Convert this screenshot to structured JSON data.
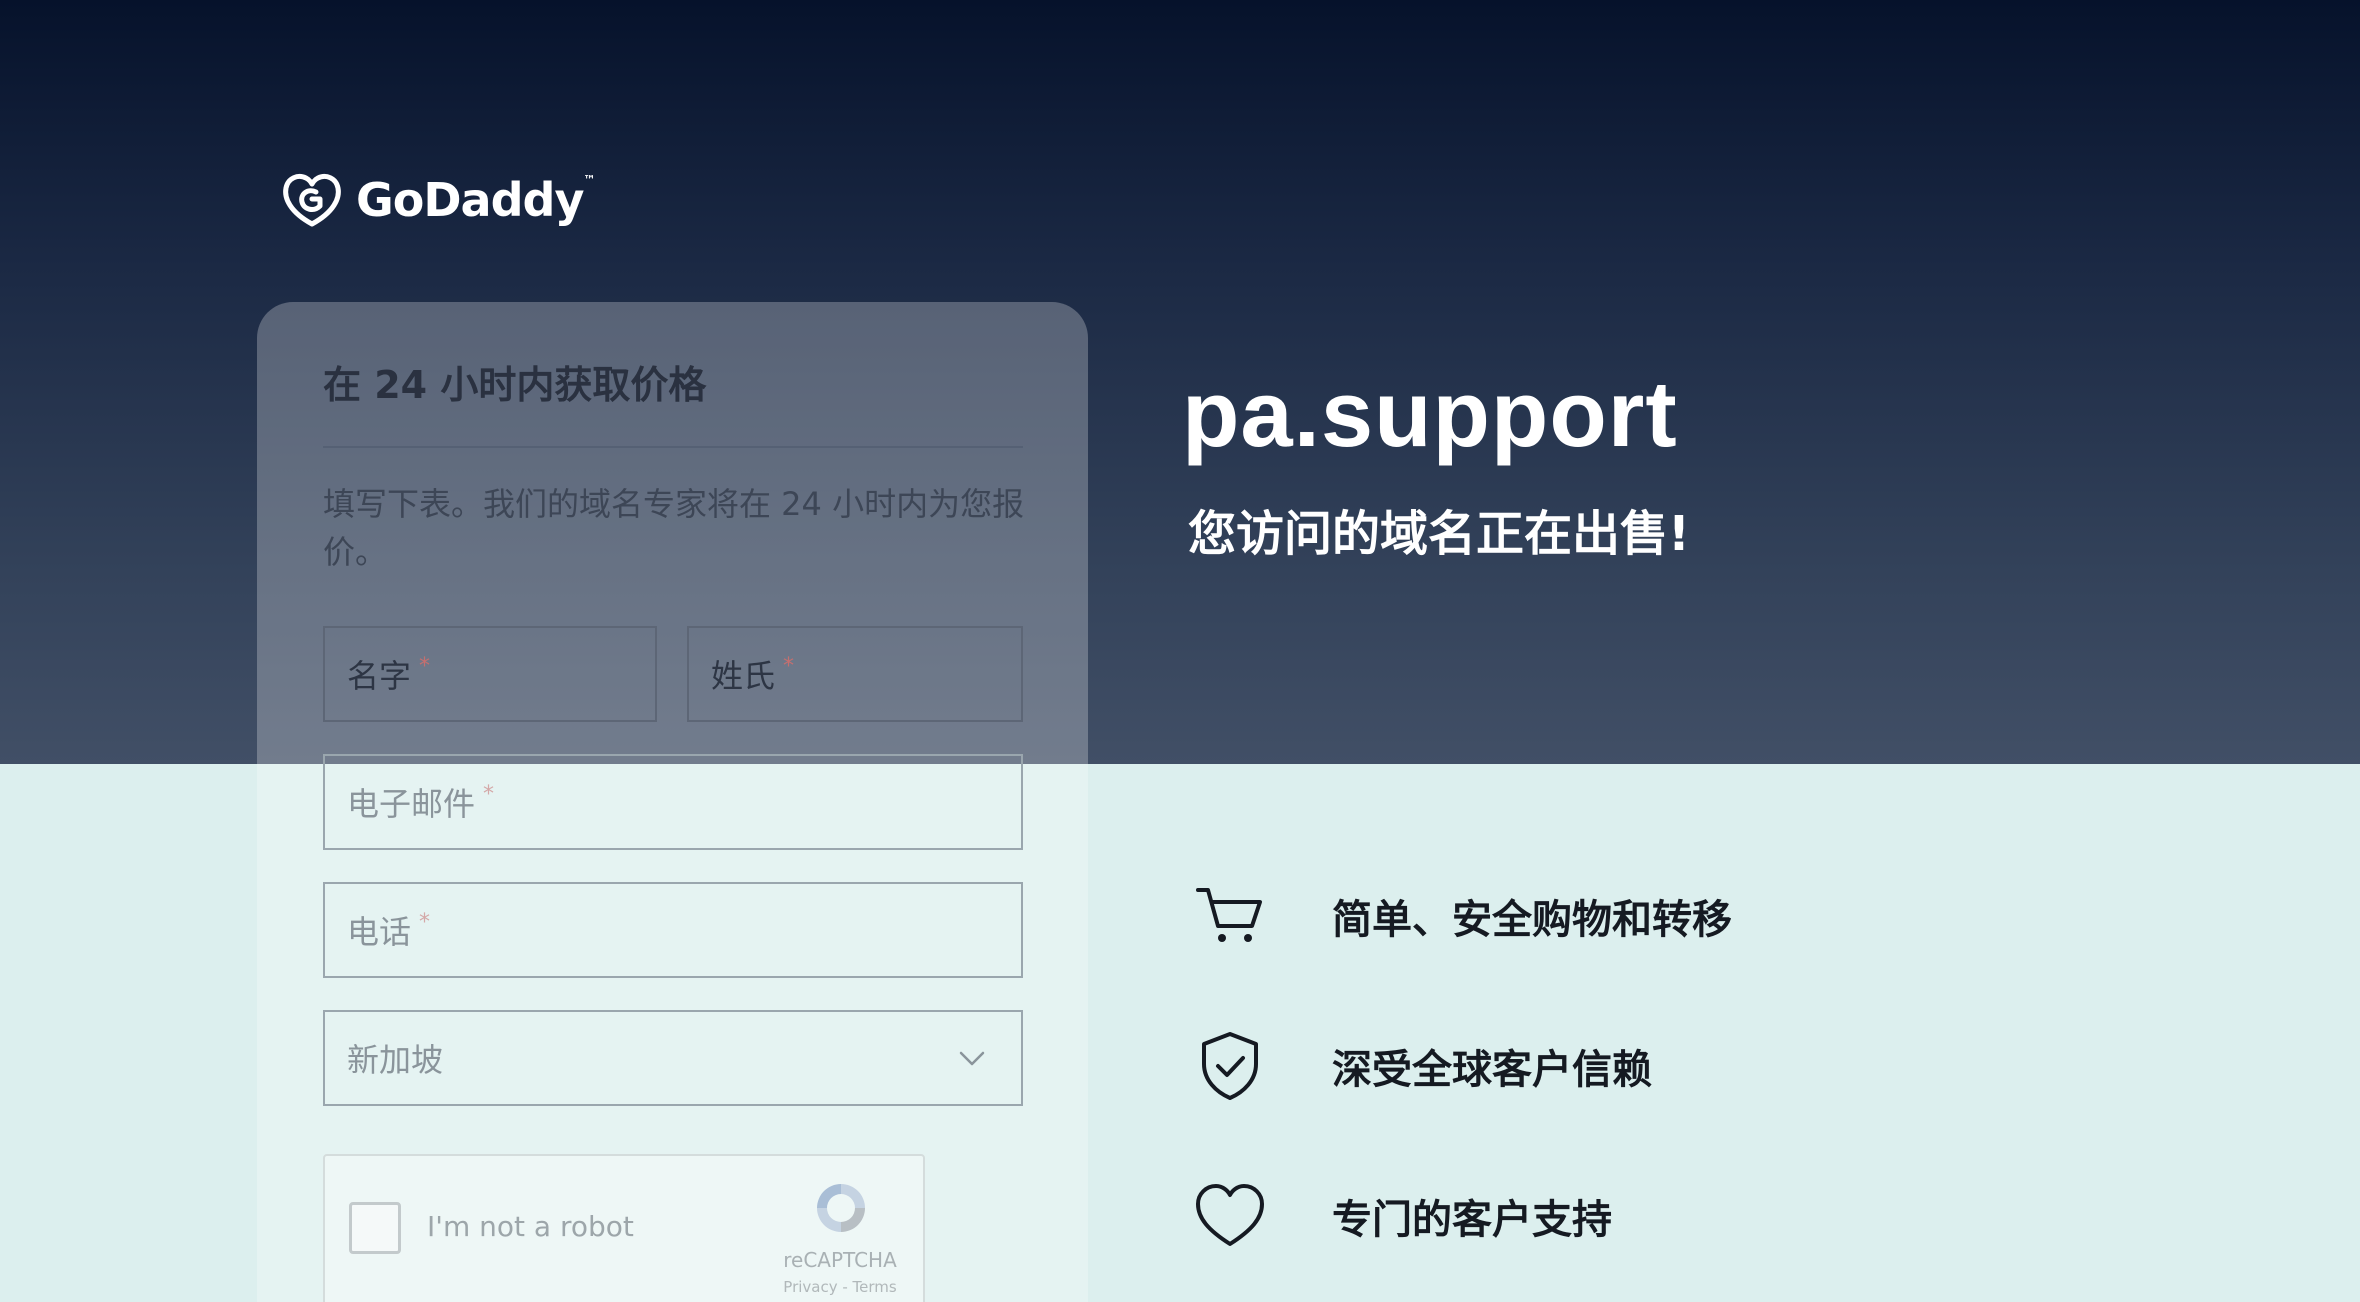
{
  "brand": {
    "name": "GoDaddy",
    "trademark": "™"
  },
  "form": {
    "title": "在 24 小时内获取价格",
    "description": "填写下表。我们的域名专家将在 24 小时内为您报价。",
    "fields": {
      "first_name": "名字",
      "last_name": "姓氏",
      "email": "电子邮件",
      "phone": "电话",
      "country": "新加坡"
    },
    "required_mark": "*"
  },
  "captcha": {
    "label": "I'm not a robot",
    "brand": "reCAPTCHA",
    "links": "Privacy - Terms"
  },
  "hero": {
    "domain": "pa.support",
    "subtitle": "您访问的域名正在出售!"
  },
  "features": [
    {
      "icon": "shopping-cart-icon",
      "label": "简单、安全购物和转移"
    },
    {
      "icon": "shield-check-icon",
      "label": "深受全球客户信赖"
    },
    {
      "icon": "heart-icon",
      "label": "专门的客户支持"
    }
  ],
  "colors": {
    "header_top": "#06122b",
    "header_bottom": "#414f66",
    "lower_background": "#dcefee",
    "text_dark": "#151a22",
    "text_light": "#ffffff"
  }
}
